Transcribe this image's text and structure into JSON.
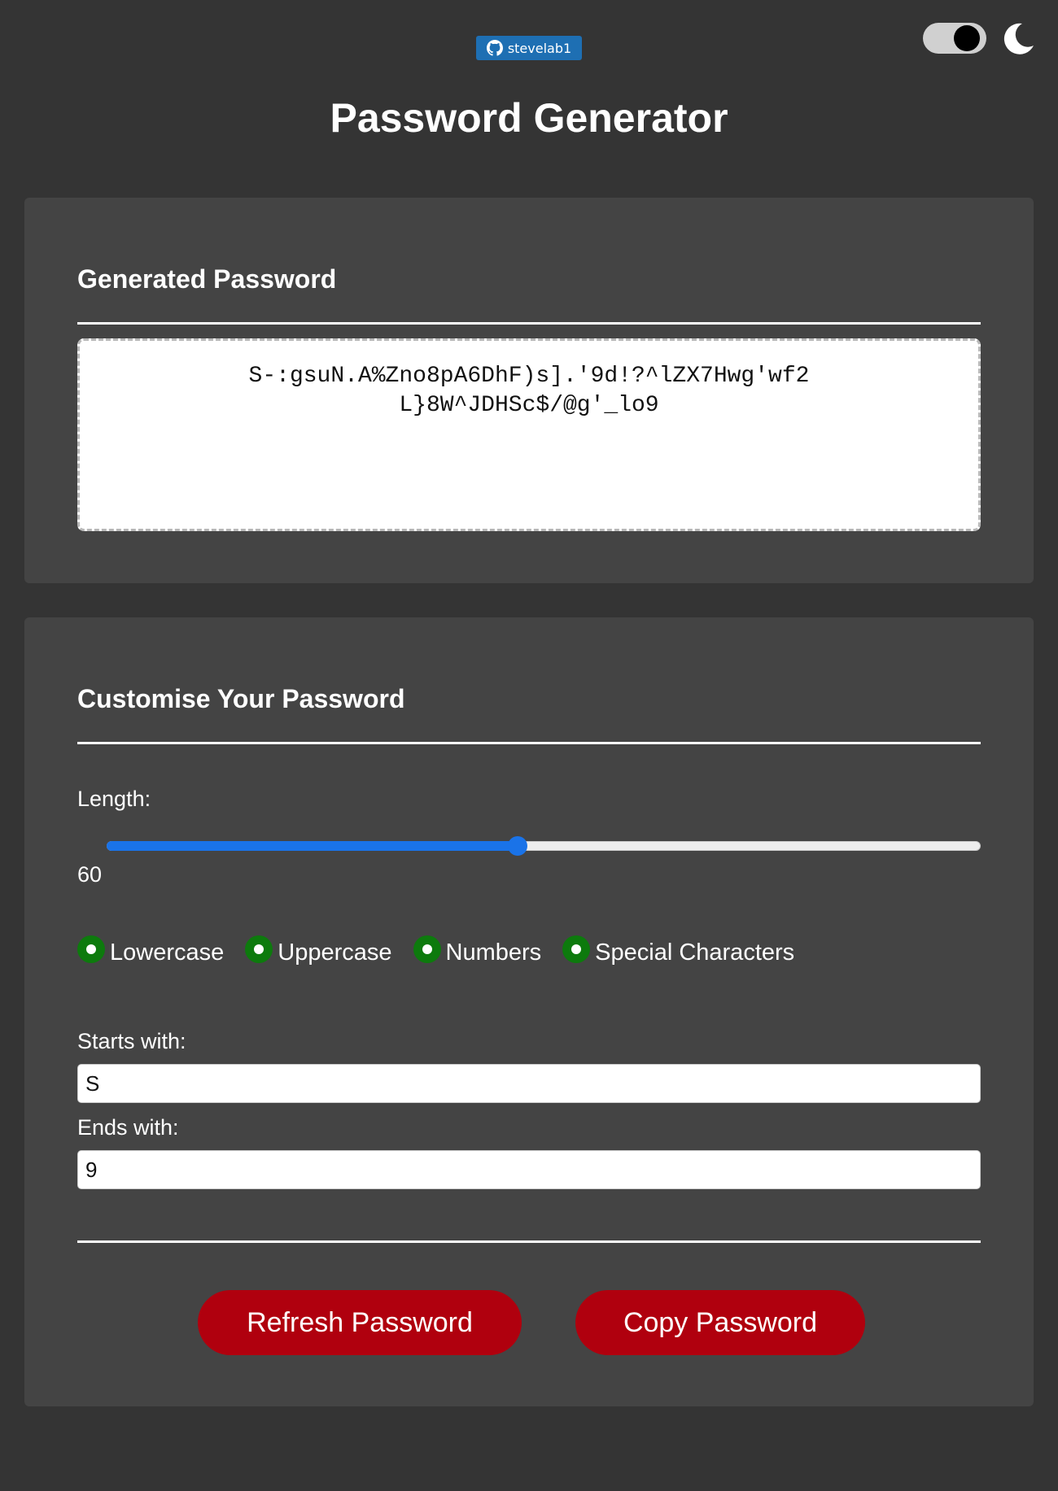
{
  "header": {
    "github_badge": {
      "icon": "github-icon",
      "label": "stevelab1"
    },
    "theme_toggle": {
      "state": "dark",
      "icon": "moon-icon"
    },
    "title": "Password Generator"
  },
  "output": {
    "heading": "Generated Password",
    "password": "S-:gsuN.A%Zno8pA6DhF)s].'9d!?^lZX7Hwg'wf2L}8W^JDHSc$/@g'_lo9"
  },
  "customise": {
    "heading": "Customise Your Password",
    "length_label": "Length:",
    "length_value": "60",
    "length_slider_fraction": 0.47,
    "options": [
      {
        "label": "Lowercase",
        "checked": true
      },
      {
        "label": "Uppercase",
        "checked": true
      },
      {
        "label": "Numbers",
        "checked": true
      },
      {
        "label": "Special Characters",
        "checked": true
      }
    ],
    "starts_with_label": "Starts with:",
    "starts_with_value": "S",
    "ends_with_label": "Ends with:",
    "ends_with_value": "9"
  },
  "actions": {
    "refresh_label": "Refresh Password",
    "copy_label": "Copy Password"
  },
  "colors": {
    "page_background": "#343434",
    "card_background": "#444444",
    "accent_blue": "#1a73e8",
    "button_red": "#b0000e",
    "radio_green": "#0d7a0d",
    "badge_blue": "#1e6fb3"
  }
}
